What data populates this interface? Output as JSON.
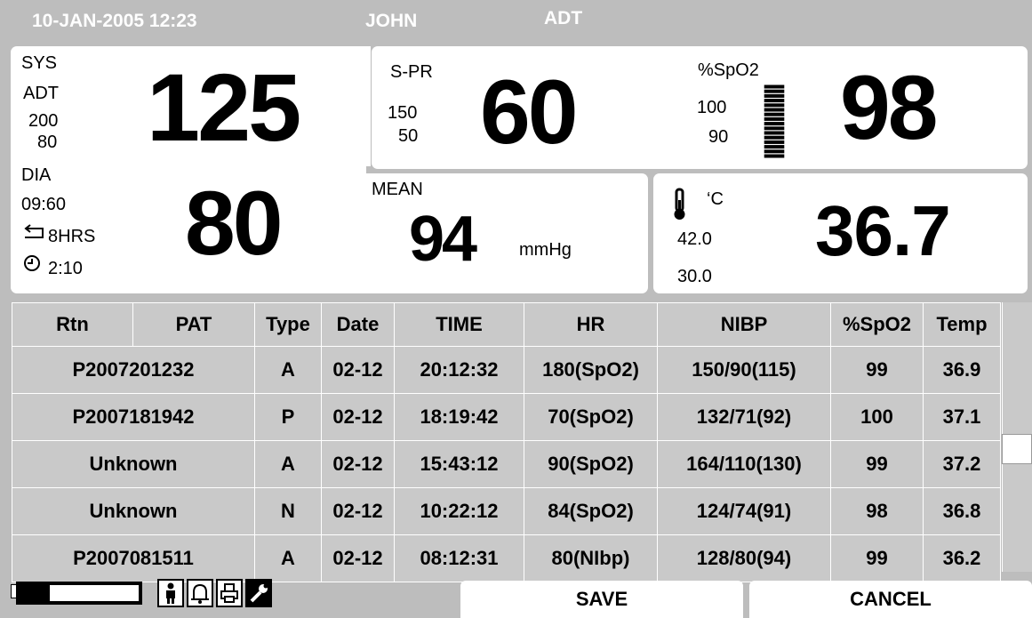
{
  "header": {
    "datetime": "10-JAN-2005 12:23",
    "patient": "JOHN",
    "mode": "ADT"
  },
  "nibp": {
    "sys_label": "SYS",
    "mode": "ADT",
    "sys_high": "200",
    "sys_low": "80",
    "sys_value": "125",
    "dia_label": "DIA",
    "interval": "09:60",
    "dia_value": "80",
    "duration": "8HRS",
    "timer": "2:10"
  },
  "pulse": {
    "label": "S-PR",
    "high": "150",
    "low": "50",
    "value": "60"
  },
  "spo2": {
    "label": "%SpO2",
    "high": "100",
    "low": "90",
    "value": "98",
    "bar_level": 1.0
  },
  "mean": {
    "label": "MEAN",
    "value": "94",
    "unit": "mmHg"
  },
  "temp": {
    "unit": "‘C",
    "high": "42.0",
    "low": "30.0",
    "value": "36.7"
  },
  "table": {
    "headers": [
      "Rtn",
      "PAT",
      "Type",
      "Date",
      "TIME",
      "HR",
      "NIBP",
      "%SpO2",
      "Temp"
    ],
    "rows": [
      [
        "P2007201232",
        "A",
        "02-12",
        "20:12:32",
        "180(SpO2)",
        "150/90(115)",
        "99",
        "36.9"
      ],
      [
        "P2007181942",
        "P",
        "02-12",
        "18:19:42",
        "70(SpO2)",
        "132/71(92)",
        "100",
        "37.1"
      ],
      [
        "Unknown",
        "A",
        "02-12",
        "15:43:12",
        "90(SpO2)",
        "164/110(130)",
        "99",
        "37.2"
      ],
      [
        "Unknown",
        "N",
        "02-12",
        "10:22:12",
        "84(SpO2)",
        "124/74(91)",
        "98",
        "36.8"
      ],
      [
        "P2007081511",
        "A",
        "02-12",
        "08:12:31",
        "80(NIbp)",
        "128/80(94)",
        "99",
        "36.2"
      ]
    ]
  },
  "footer": {
    "battery_level": 0.25,
    "icons": [
      "patient-icon",
      "alarm-bell-icon",
      "printer-icon",
      "wrench-icon"
    ],
    "save_label": "SAVE",
    "cancel_label": "CANCEL"
  }
}
